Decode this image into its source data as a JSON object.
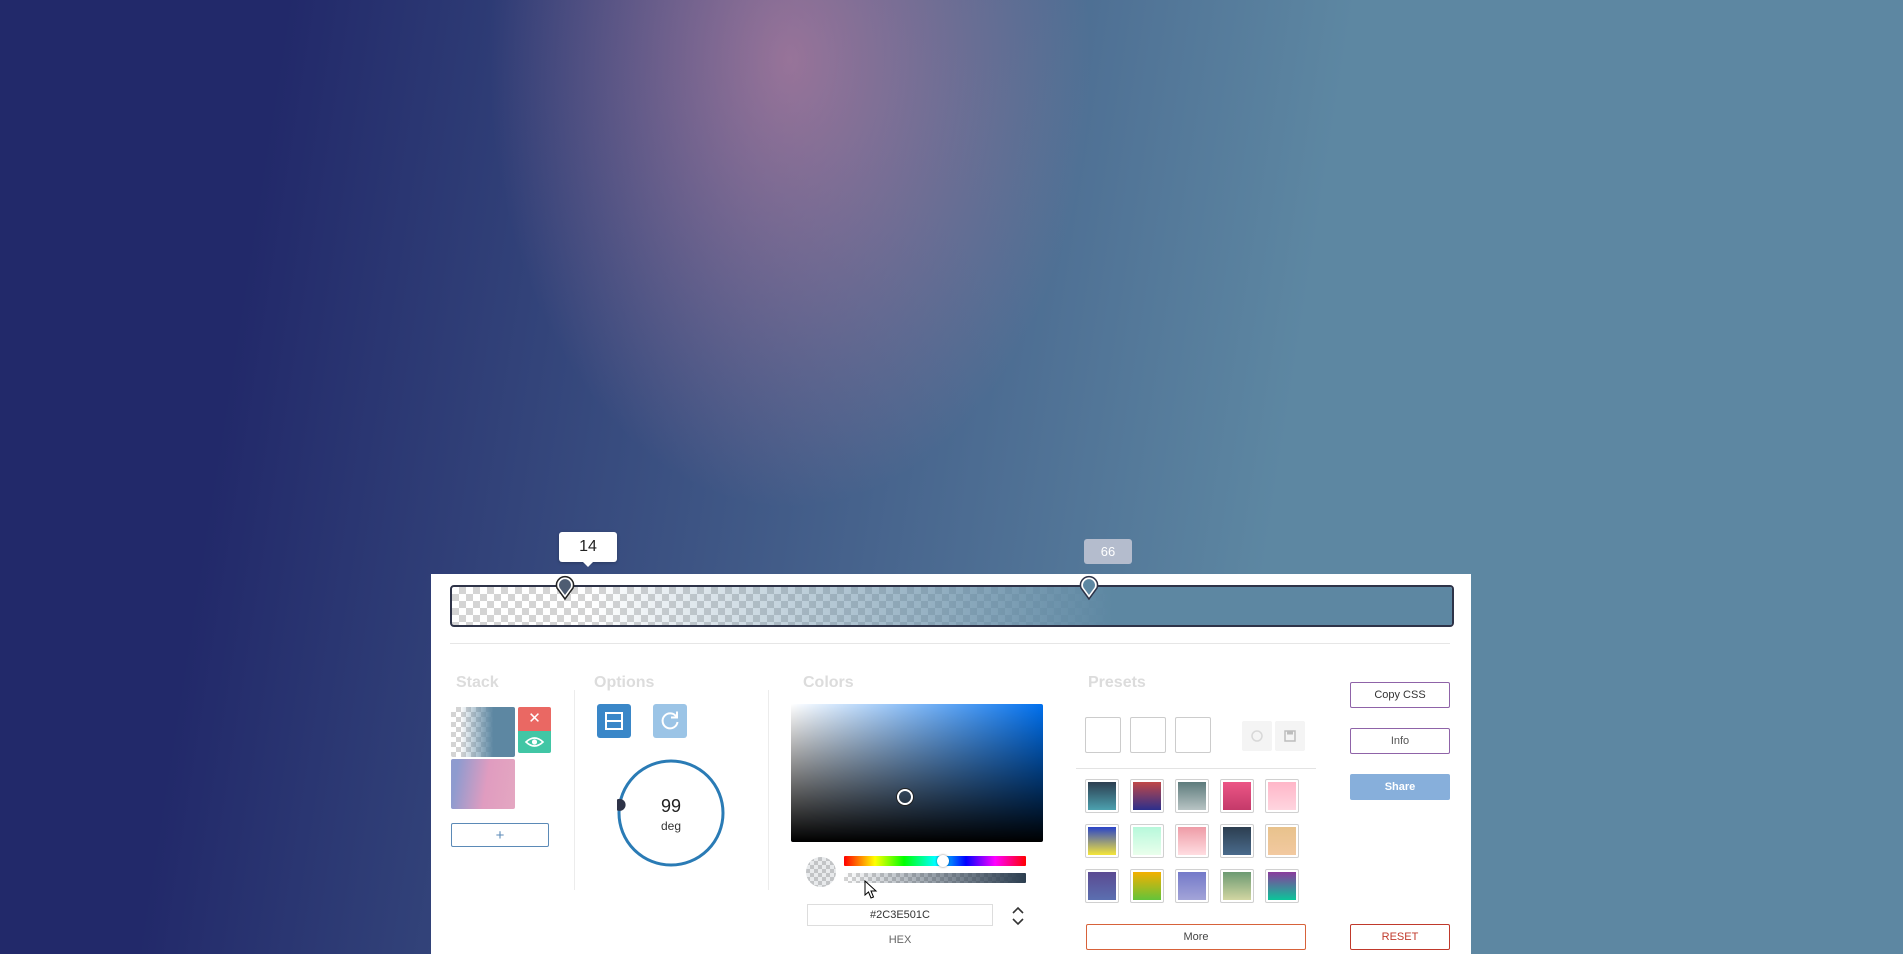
{
  "gradient": {
    "angle": "99",
    "stops": [
      {
        "position": "14",
        "color": "#22296A"
      },
      {
        "position": "66",
        "color": "#5D87A2"
      }
    ],
    "glow_color": "#E18CAA"
  },
  "sections": {
    "stack": "Stack",
    "options": "Options",
    "colors": "Colors",
    "presets": "Presets"
  },
  "stack": {
    "add_label": "+",
    "delete_glyph": "✕",
    "layers": [
      {
        "name": "layer-current"
      },
      {
        "name": "layer-pink"
      }
    ]
  },
  "options": {
    "angle_value": "99",
    "angle_unit": "deg"
  },
  "picker": {
    "hex_value": "#2C3E501C",
    "hex_label": "HEX",
    "hue_level": 0.58,
    "alpha_level": 0.11
  },
  "presets": {
    "swatches": [
      [
        "#2c3e50",
        "#4ca1af"
      ],
      [
        "#c04848",
        "#2c2f8c"
      ],
      [
        "#5d7b7c",
        "#b8c4c4"
      ],
      [
        "#ec5586",
        "#c43a6a"
      ],
      [
        "#ffb6c8",
        "#ffd5df"
      ],
      [
        "#2a44c8",
        "#f5e63a"
      ],
      [
        "#b7f8db",
        "#eaffec"
      ],
      [
        "#ee9ca7",
        "#ffdde1"
      ],
      [
        "#2c3e50",
        "#4a6b8c"
      ],
      [
        "#e8c28c",
        "#f2c9a0"
      ],
      [
        "#5b4a92",
        "#5b6fb0"
      ],
      [
        "#f4b000",
        "#63c33a"
      ],
      [
        "#7379c9",
        "#a3a4d8"
      ],
      [
        "#6c9a72",
        "#d2d6a2"
      ],
      [
        "#8b3a9c",
        "#0bc59a"
      ]
    ]
  },
  "actions": {
    "copy_css": "Copy CSS",
    "info": "Info",
    "share": "Share",
    "more": "More",
    "reset": "RESET"
  }
}
